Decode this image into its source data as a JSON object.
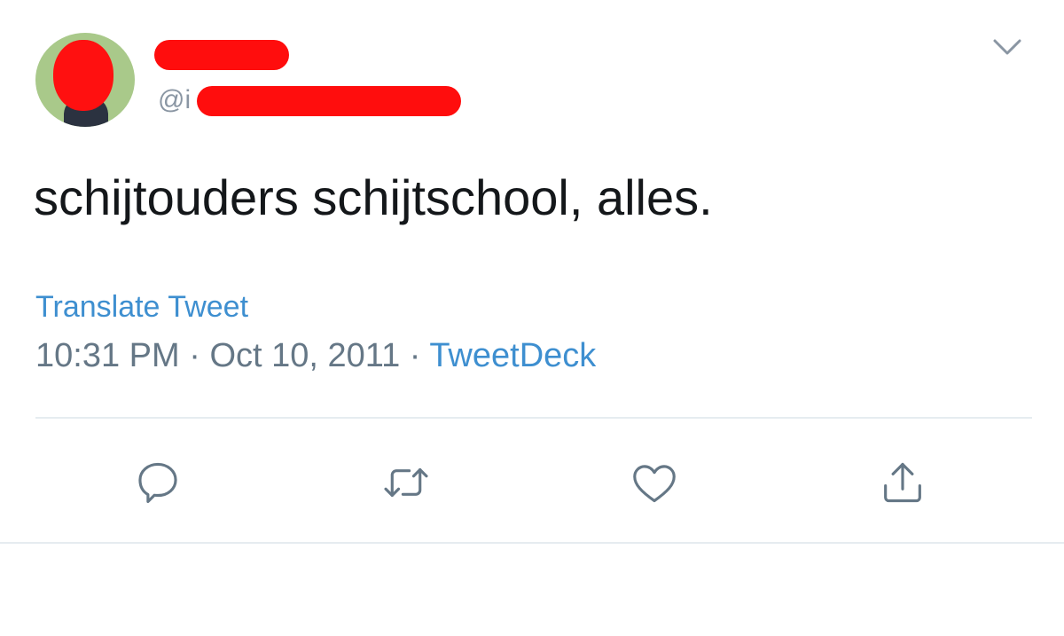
{
  "tweet": {
    "handle_prefix": "@i",
    "text": "schijtouders schijtschool, alles.",
    "translate_label": "Translate Tweet",
    "time": "10:31 PM",
    "separator_1": " · ",
    "date": "Oct 10, 2011",
    "separator_2": " · ",
    "source": "TweetDeck"
  },
  "actions": [
    {
      "icon": "reply-icon"
    },
    {
      "icon": "retweet-icon"
    },
    {
      "icon": "like-icon"
    },
    {
      "icon": "share-icon"
    }
  ],
  "colors": {
    "text": "#14171a",
    "secondary": "#657786",
    "link": "#3e8fd0",
    "redaction": "#ff0d0d",
    "divider": "#e6ecf0",
    "icon": "#657786"
  }
}
